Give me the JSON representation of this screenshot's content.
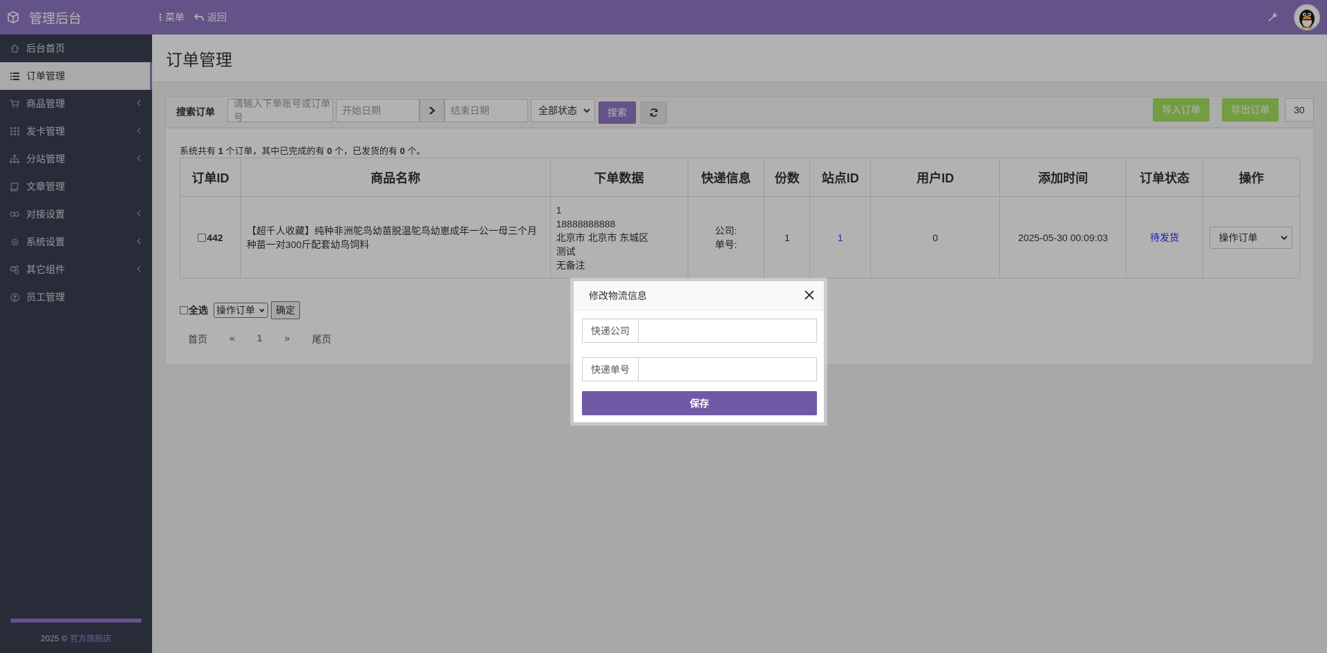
{
  "topbar": {
    "brand": "管理后台",
    "menu_label": "菜单",
    "back_label": "返回"
  },
  "sidebar": {
    "items": [
      {
        "label": "后台首页",
        "icon": "home-icon",
        "has_submenu": false,
        "active": false
      },
      {
        "label": "订单管理",
        "icon": "list-icon",
        "has_submenu": false,
        "active": true
      },
      {
        "label": "商品管理",
        "icon": "cart-icon",
        "has_submenu": true,
        "active": false
      },
      {
        "label": "发卡管理",
        "icon": "grid-icon",
        "has_submenu": true,
        "active": false
      },
      {
        "label": "分站管理",
        "icon": "sitemap-icon",
        "has_submenu": true,
        "active": false
      },
      {
        "label": "文章管理",
        "icon": "book-icon",
        "has_submenu": false,
        "active": false
      },
      {
        "label": "对接设置",
        "icon": "link-icon",
        "has_submenu": true,
        "active": false
      },
      {
        "label": "系统设置",
        "icon": "gear-icon",
        "has_submenu": true,
        "active": false
      },
      {
        "label": "其它组件",
        "icon": "cogs-icon",
        "has_submenu": true,
        "active": false
      },
      {
        "label": "员工管理",
        "icon": "user-icon",
        "has_submenu": false,
        "active": false
      }
    ],
    "footer_year": "2025 ©",
    "footer_link": "官方旗舰店"
  },
  "page": {
    "title": "订单管理"
  },
  "search": {
    "label": "搜索订单",
    "keyword_placeholder": "请输入下单账号或订单号",
    "start_placeholder": "开始日期",
    "end_placeholder": "结束日期",
    "status_selected": "全部状态",
    "search_button": "搜索",
    "import_button": "导入订单",
    "export_button": "导出订单",
    "page_size": "30"
  },
  "summary": {
    "prefix": "系统共有",
    "total": "1",
    "mid1": "个订单，其中已完成的有",
    "completed": "0",
    "mid2": "个，已发货的有",
    "shipped": "0",
    "suffix": "个。"
  },
  "table": {
    "headers": [
      "订单ID",
      "商品名称",
      "下单数据",
      "快递信息",
      "份数",
      "站点ID",
      "用户ID",
      "添加时间",
      "订单状态",
      "操作"
    ],
    "rows": [
      {
        "id": "442",
        "goods": "【超千人收藏】纯种非洲鸵鸟幼苗脱温鸵鸟幼崽成年一公一母三个月种苗一对300斤配套幼鸟饲料",
        "order_data": [
          "1",
          "18888888888",
          "北京市 北京市 东城区",
          "测试",
          "无备注"
        ],
        "express_company": "公司:",
        "express_no": "单号:",
        "qty": "1",
        "site_id": "1",
        "user_id": "0",
        "time": "2025-05-30 00:09:03",
        "status": "待发货",
        "action": "操作订单"
      }
    ]
  },
  "bulk": {
    "select_all": "全选",
    "action_selected": "操作订单",
    "confirm": "确定"
  },
  "pager": {
    "first": "首页",
    "prev": "«",
    "current": "1",
    "next": "»",
    "last": "尾页"
  },
  "modal": {
    "title": "修改物流信息",
    "company_label": "快递公司",
    "number_label": "快递单号",
    "company_value": "",
    "number_value": "",
    "save_button": "保存"
  },
  "colors": {
    "brand": "#8e78c5",
    "sidebar": "#3a3f51",
    "green": "#a8e061",
    "save": "#7059a5"
  }
}
